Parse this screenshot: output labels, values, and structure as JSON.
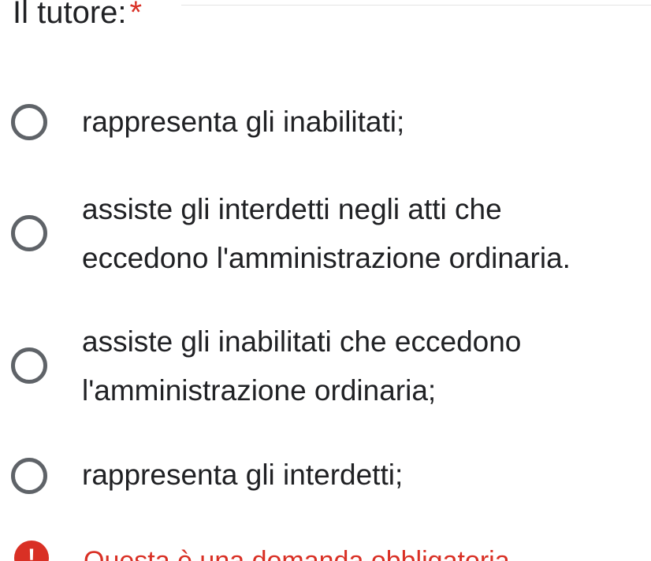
{
  "question": {
    "title": "Il tutore:",
    "required_marker": "*"
  },
  "options": [
    {
      "label_lines": [
        "rappresenta gli inabilitati;"
      ],
      "selected": false
    },
    {
      "label_lines": [
        "assiste gli interdetti negli atti che",
        "eccedono l'amministrazione ordinaria."
      ],
      "selected": false
    },
    {
      "label_lines": [
        "assiste gli inabilitati che eccedono",
        "l'amministrazione ordinaria;"
      ],
      "selected": false
    },
    {
      "label_lines": [
        "rappresenta gli interdetti;"
      ],
      "selected": false
    }
  ],
  "validation": {
    "icon": "error-icon",
    "icon_glyph": "!",
    "message": "Questa è una domanda obbligatoria"
  },
  "colors": {
    "text": "#202124",
    "radio_border": "#5f6368",
    "required": "#d93025",
    "error": "#d93025"
  }
}
